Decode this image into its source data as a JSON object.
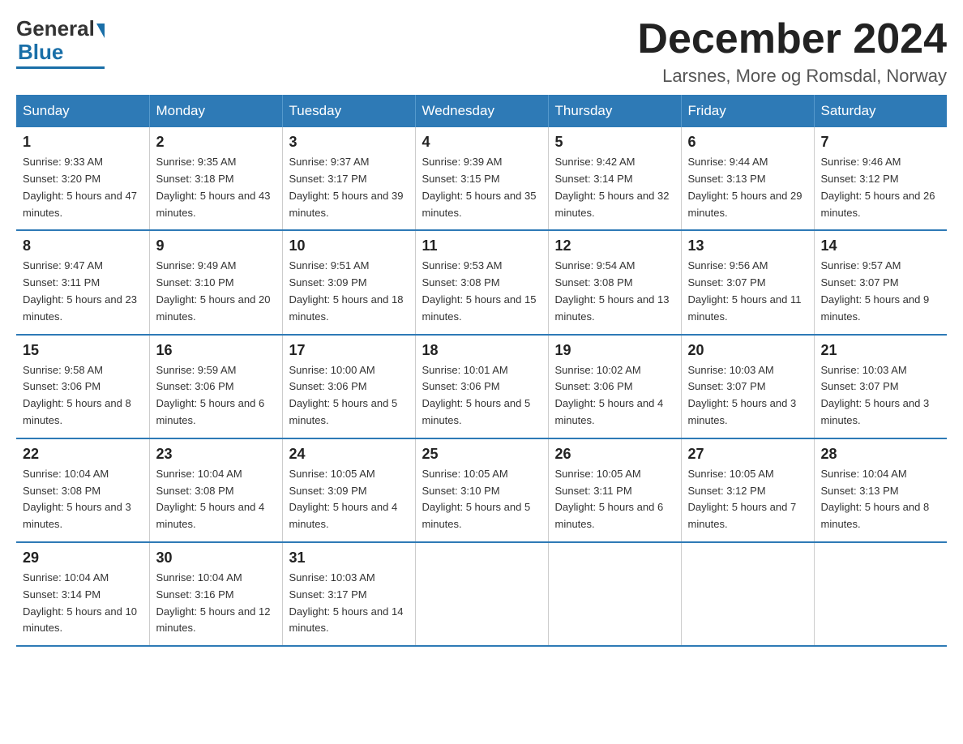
{
  "logo": {
    "general": "General",
    "blue": "Blue"
  },
  "title": "December 2024",
  "location": "Larsnes, More og Romsdal, Norway",
  "days_of_week": [
    "Sunday",
    "Monday",
    "Tuesday",
    "Wednesday",
    "Thursday",
    "Friday",
    "Saturday"
  ],
  "weeks": [
    [
      {
        "day": "1",
        "sunrise": "9:33 AM",
        "sunset": "3:20 PM",
        "daylight": "5 hours and 47 minutes."
      },
      {
        "day": "2",
        "sunrise": "9:35 AM",
        "sunset": "3:18 PM",
        "daylight": "5 hours and 43 minutes."
      },
      {
        "day": "3",
        "sunrise": "9:37 AM",
        "sunset": "3:17 PM",
        "daylight": "5 hours and 39 minutes."
      },
      {
        "day": "4",
        "sunrise": "9:39 AM",
        "sunset": "3:15 PM",
        "daylight": "5 hours and 35 minutes."
      },
      {
        "day": "5",
        "sunrise": "9:42 AM",
        "sunset": "3:14 PM",
        "daylight": "5 hours and 32 minutes."
      },
      {
        "day": "6",
        "sunrise": "9:44 AM",
        "sunset": "3:13 PM",
        "daylight": "5 hours and 29 minutes."
      },
      {
        "day": "7",
        "sunrise": "9:46 AM",
        "sunset": "3:12 PM",
        "daylight": "5 hours and 26 minutes."
      }
    ],
    [
      {
        "day": "8",
        "sunrise": "9:47 AM",
        "sunset": "3:11 PM",
        "daylight": "5 hours and 23 minutes."
      },
      {
        "day": "9",
        "sunrise": "9:49 AM",
        "sunset": "3:10 PM",
        "daylight": "5 hours and 20 minutes."
      },
      {
        "day": "10",
        "sunrise": "9:51 AM",
        "sunset": "3:09 PM",
        "daylight": "5 hours and 18 minutes."
      },
      {
        "day": "11",
        "sunrise": "9:53 AM",
        "sunset": "3:08 PM",
        "daylight": "5 hours and 15 minutes."
      },
      {
        "day": "12",
        "sunrise": "9:54 AM",
        "sunset": "3:08 PM",
        "daylight": "5 hours and 13 minutes."
      },
      {
        "day": "13",
        "sunrise": "9:56 AM",
        "sunset": "3:07 PM",
        "daylight": "5 hours and 11 minutes."
      },
      {
        "day": "14",
        "sunrise": "9:57 AM",
        "sunset": "3:07 PM",
        "daylight": "5 hours and 9 minutes."
      }
    ],
    [
      {
        "day": "15",
        "sunrise": "9:58 AM",
        "sunset": "3:06 PM",
        "daylight": "5 hours and 8 minutes."
      },
      {
        "day": "16",
        "sunrise": "9:59 AM",
        "sunset": "3:06 PM",
        "daylight": "5 hours and 6 minutes."
      },
      {
        "day": "17",
        "sunrise": "10:00 AM",
        "sunset": "3:06 PM",
        "daylight": "5 hours and 5 minutes."
      },
      {
        "day": "18",
        "sunrise": "10:01 AM",
        "sunset": "3:06 PM",
        "daylight": "5 hours and 5 minutes."
      },
      {
        "day": "19",
        "sunrise": "10:02 AM",
        "sunset": "3:06 PM",
        "daylight": "5 hours and 4 minutes."
      },
      {
        "day": "20",
        "sunrise": "10:03 AM",
        "sunset": "3:07 PM",
        "daylight": "5 hours and 3 minutes."
      },
      {
        "day": "21",
        "sunrise": "10:03 AM",
        "sunset": "3:07 PM",
        "daylight": "5 hours and 3 minutes."
      }
    ],
    [
      {
        "day": "22",
        "sunrise": "10:04 AM",
        "sunset": "3:08 PM",
        "daylight": "5 hours and 3 minutes."
      },
      {
        "day": "23",
        "sunrise": "10:04 AM",
        "sunset": "3:08 PM",
        "daylight": "5 hours and 4 minutes."
      },
      {
        "day": "24",
        "sunrise": "10:05 AM",
        "sunset": "3:09 PM",
        "daylight": "5 hours and 4 minutes."
      },
      {
        "day": "25",
        "sunrise": "10:05 AM",
        "sunset": "3:10 PM",
        "daylight": "5 hours and 5 minutes."
      },
      {
        "day": "26",
        "sunrise": "10:05 AM",
        "sunset": "3:11 PM",
        "daylight": "5 hours and 6 minutes."
      },
      {
        "day": "27",
        "sunrise": "10:05 AM",
        "sunset": "3:12 PM",
        "daylight": "5 hours and 7 minutes."
      },
      {
        "day": "28",
        "sunrise": "10:04 AM",
        "sunset": "3:13 PM",
        "daylight": "5 hours and 8 minutes."
      }
    ],
    [
      {
        "day": "29",
        "sunrise": "10:04 AM",
        "sunset": "3:14 PM",
        "daylight": "5 hours and 10 minutes."
      },
      {
        "day": "30",
        "sunrise": "10:04 AM",
        "sunset": "3:16 PM",
        "daylight": "5 hours and 12 minutes."
      },
      {
        "day": "31",
        "sunrise": "10:03 AM",
        "sunset": "3:17 PM",
        "daylight": "5 hours and 14 minutes."
      },
      null,
      null,
      null,
      null
    ]
  ],
  "labels": {
    "sunrise": "Sunrise:",
    "sunset": "Sunset:",
    "daylight": "Daylight:"
  }
}
